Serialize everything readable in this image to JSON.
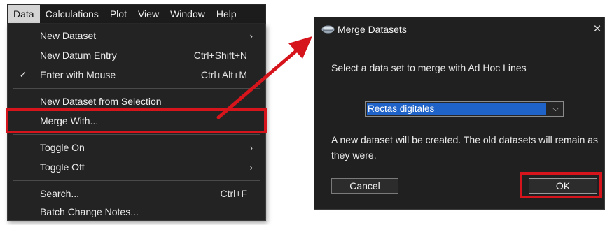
{
  "menubar": {
    "items": [
      {
        "label": "Data",
        "active": true
      },
      {
        "label": "Calculations"
      },
      {
        "label": "Plot"
      },
      {
        "label": "View"
      },
      {
        "label": "Window"
      },
      {
        "label": "Help"
      }
    ]
  },
  "menu": {
    "items": [
      {
        "label": "New Dataset",
        "submenu": true,
        "submenu_glyph": "›"
      },
      {
        "label": "New Datum Entry",
        "shortcut": "Ctrl+Shift+N"
      },
      {
        "label": "Enter with Mouse",
        "shortcut": "Ctrl+Alt+M",
        "checked": true,
        "check_glyph": "✓"
      },
      {
        "label": "New Dataset from Selection"
      },
      {
        "label": "Merge With...",
        "highlighted": true
      },
      {
        "label": "Toggle On",
        "submenu": true,
        "submenu_glyph": "›"
      },
      {
        "label": "Toggle Off",
        "submenu": true,
        "submenu_glyph": "›"
      },
      {
        "label": "Search...",
        "shortcut": "Ctrl+F"
      },
      {
        "label": "Batch Change Notes..."
      }
    ]
  },
  "dialog": {
    "title": "Merge Datasets",
    "close_glyph": "×",
    "prompt": "Select a data set to merge with Ad Hoc Lines",
    "dataset_select": {
      "value": "Rectas digitales",
      "caret_glyph": "⌵"
    },
    "info": "A new dataset will be created. The old datasets will remain as they were.",
    "cancel_label": "Cancel",
    "ok_label": "OK"
  },
  "annotations": {
    "highlight_color": "#d6141c",
    "highlights": [
      "Merge With...",
      "OK"
    ],
    "arrow": "from Merge With... to Merge Datasets dialog"
  },
  "colors": {
    "menu_bg": "#232323",
    "menubar_bg": "#1c1c1c",
    "dialog_bg": "#202020",
    "selection_blue": "#1f62c8"
  }
}
